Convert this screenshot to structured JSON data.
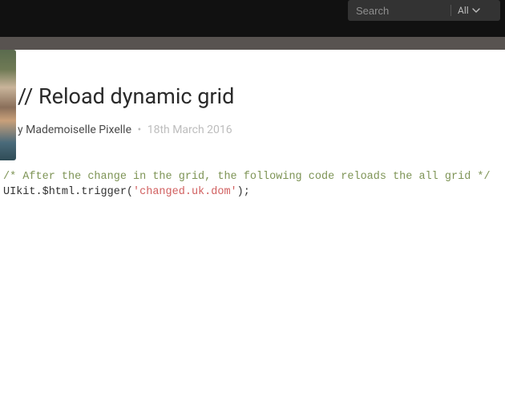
{
  "topbar": {
    "search_placeholder": "Search",
    "filter_label": "All"
  },
  "snippet": {
    "title": "// Reload dynamic grid",
    "byline_prefix": "y",
    "author": "Mademoiselle Pixelle",
    "separator": "•",
    "date": "18th March 2016"
  },
  "code": {
    "comment": "/* After the change in the grid, the following code reloads the all grid */",
    "call_head": "UIkit.$html.trigger(",
    "string_arg": "'changed.uk.dom'",
    "call_tail": ");"
  }
}
